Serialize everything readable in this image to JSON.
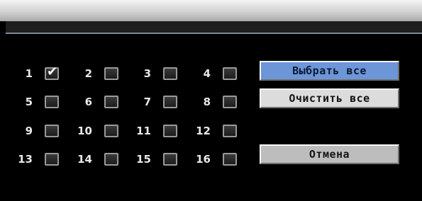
{
  "channels": [
    {
      "label": "1",
      "checked": true
    },
    {
      "label": "2",
      "checked": false
    },
    {
      "label": "3",
      "checked": false
    },
    {
      "label": "4",
      "checked": false
    },
    {
      "label": "5",
      "checked": false
    },
    {
      "label": "6",
      "checked": false
    },
    {
      "label": "7",
      "checked": false
    },
    {
      "label": "8",
      "checked": false
    },
    {
      "label": "9",
      "checked": false
    },
    {
      "label": "10",
      "checked": false
    },
    {
      "label": "11",
      "checked": false
    },
    {
      "label": "12",
      "checked": false
    },
    {
      "label": "13",
      "checked": false
    },
    {
      "label": "14",
      "checked": false
    },
    {
      "label": "15",
      "checked": false
    },
    {
      "label": "16",
      "checked": false
    }
  ],
  "buttons": {
    "select_all": "Выбрать все",
    "clear_all": "Очистить все",
    "cancel": "Отмена"
  },
  "checkmark_glyph": "✔",
  "colors": {
    "select_button_bg": "#6d96d9",
    "clear_button_bg": "#dcdcdc",
    "cancel_button_bg": "#bdbdbd",
    "background": "#000000"
  }
}
